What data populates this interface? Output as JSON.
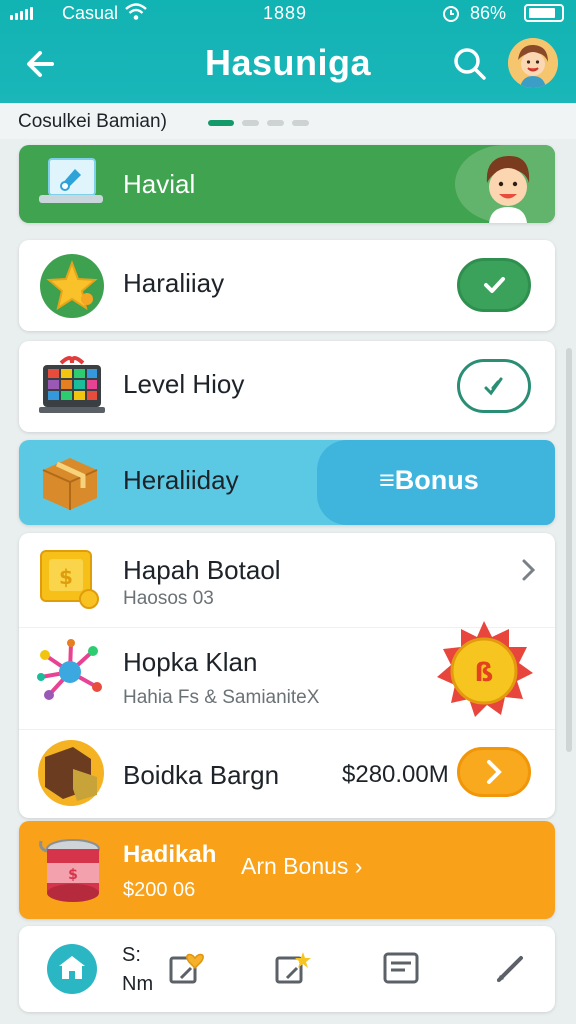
{
  "status_bar": {
    "carrier": "Casual",
    "time": "1889",
    "battery": "86%"
  },
  "header": {
    "title": "Hasuniga"
  },
  "subheader": {
    "title": "Cosulkei Bamian)",
    "page_indicator": {
      "pages": 4,
      "active": 1
    }
  },
  "items": {
    "banner": {
      "label": "Havial",
      "color": "#3fa34f"
    },
    "holiday": {
      "label": "Haraliiay",
      "checked": true
    },
    "level": {
      "label": "Level Hioy",
      "checked": false
    },
    "bonus_row": {
      "label": "Heraliiday",
      "bonus_label": "≡Bonus"
    },
    "list": [
      {
        "label": "Hapah Botaol",
        "sublabel": "Haosos 03",
        "action_icon": "chevron-right-icon"
      },
      {
        "label": "Hopka Klan",
        "sublabel": "Hahia Fs & SamianiteX",
        "badge_icon": "sun-badge-icon"
      },
      {
        "label": "Boidka Bargn",
        "price": "$280.00M",
        "action_icon": "arrow-right-icon"
      }
    ],
    "promo": {
      "label": "Hadikah",
      "cta": "Arn Bonus ›",
      "sublabel": "$200 06",
      "color": "#f8a119"
    }
  },
  "bottom_nav": {
    "label_top": "S:",
    "label_bottom": "Nm",
    "icons": [
      "home-icon",
      "heart-share-icon",
      "star-share-icon",
      "notes-icon",
      "pencil-icon"
    ]
  },
  "colors": {
    "header": "#14b4b6",
    "accent_green": "#3aa25a",
    "accent_blue": "#5cc9e4",
    "accent_orange": "#f8a119"
  }
}
